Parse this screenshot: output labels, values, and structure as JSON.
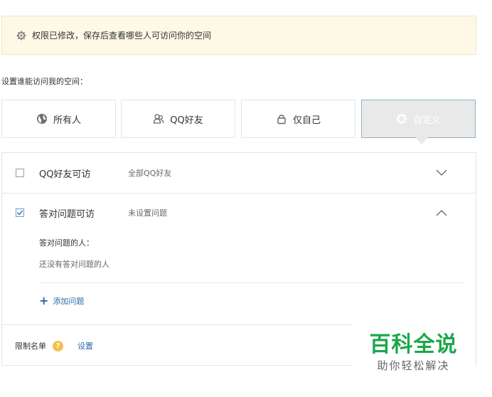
{
  "notice": {
    "text": "权限已修改，保存后查看哪些人可访问你的空间",
    "icon": "gear-icon"
  },
  "section_label": "设置谁能访问我的空间：",
  "options": [
    {
      "label": "所有人",
      "icon": "globe-icon",
      "selected": false
    },
    {
      "label": "QQ好友",
      "icon": "friends-icon",
      "selected": false
    },
    {
      "label": "仅自己",
      "icon": "lock-icon",
      "selected": false
    },
    {
      "label": "自定义",
      "icon": "gear-icon",
      "selected": true
    }
  ],
  "rules": [
    {
      "title": "QQ好友可访",
      "desc": "全部QQ好友",
      "checked": false,
      "expanded": false
    },
    {
      "title": "答对问题可访",
      "desc": "未设置问题",
      "checked": true,
      "expanded": true
    }
  ],
  "question_section": {
    "label": "答对问题的人：",
    "empty_text": "还没有答对问题的人",
    "add_label": "添加问题"
  },
  "restriction": {
    "label": "限制名单",
    "help": "?",
    "link": "设置"
  },
  "watermark": {
    "main": "百科全说",
    "sub": "助你轻松解决"
  },
  "colors": {
    "accent": "#2a6aa8",
    "notice_bg": "#fdf9e6",
    "help": "#f5c04a",
    "watermark": "#1aa84a"
  }
}
